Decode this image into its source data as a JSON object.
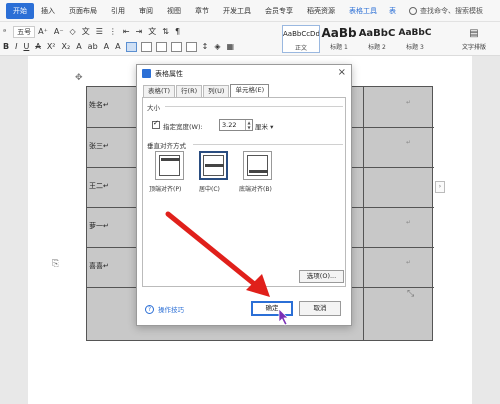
{
  "menubar": {
    "items": [
      "开始",
      "插入",
      "页面布局",
      "引用",
      "审阅",
      "视图",
      "章节",
      "开发工具",
      "会员专享",
      "稻壳资源"
    ],
    "contextual": [
      "表格工具",
      "表"
    ],
    "search_label": "查找命令、搜索模板"
  },
  "ribbon": {
    "font_size": "五号",
    "styles": [
      {
        "sample": "AaBbCcDd",
        "name": "正文"
      },
      {
        "sample": "AaBb",
        "name": "标题 1"
      },
      {
        "sample": "AaBbC",
        "name": "标题 2"
      },
      {
        "sample": "AaBbC",
        "name": "标题 3"
      }
    ],
    "text_tools_label": "文字排版"
  },
  "document": {
    "rows": [
      "姓名↵",
      "张三↵",
      "王二↵",
      "萝一↵",
      "喜喜↵"
    ]
  },
  "dialog": {
    "title": "表格属性",
    "close": "×",
    "tabs": [
      "表格(T)",
      "行(R)",
      "列(U)",
      "单元格(E)"
    ],
    "size_label": "大小",
    "width_checkbox_label": "指定宽度(W):",
    "width_value": "3.22",
    "unit": "厘米",
    "valign_label": "垂直对齐方式",
    "valign_options": [
      "顶端对齐(P)",
      "居中(C)",
      "底端对齐(B)"
    ],
    "options_button": "选项(O)...",
    "tips_label": "操作技巧",
    "ok_button": "确定",
    "cancel_button": "取消"
  },
  "colors": {
    "accent": "#2b6fd6",
    "arrow": "#e0201b",
    "cursor": "#7a2fb6"
  }
}
